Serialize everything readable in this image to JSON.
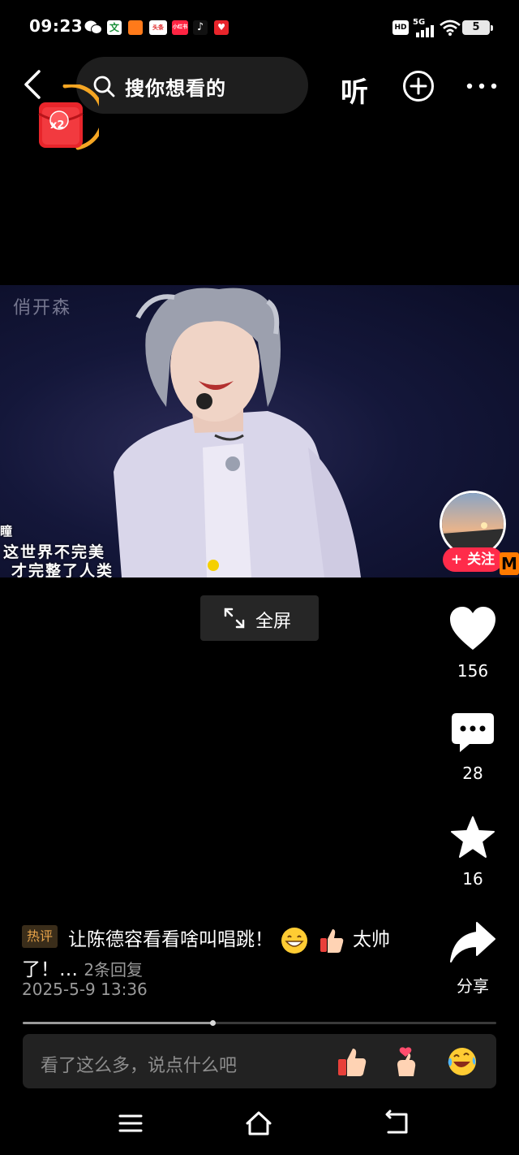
{
  "status_bar": {
    "time": "09:23",
    "notif_icons": [
      "wechat-icon",
      "wen-app-icon",
      "taobao-app-icon",
      "toutiao-app-icon",
      "xiaohongshu-app-icon",
      "douyin-app-icon",
      "red-app-icon"
    ],
    "notif_labels": [
      "",
      "文",
      "",
      "头条",
      "小红书",
      "",
      ""
    ],
    "hd_label": "HD",
    "network_label": "5G",
    "battery": "5"
  },
  "top_nav": {
    "search_placeholder": "搜你想看的",
    "listen_label": "听"
  },
  "red_packet": {
    "multiplier": "x2"
  },
  "video": {
    "watermark": "俏开森",
    "subtitle_fragment": "瞳",
    "subtitle_line1": "这世界不完美",
    "subtitle_line2": "才完整了人类",
    "brand_letter": "M"
  },
  "author": {
    "follow_label": "+ 关注"
  },
  "fullscreen": {
    "label": "全屏"
  },
  "actions": {
    "likes": "156",
    "comments": "28",
    "favorites": "16",
    "share_label": "分享"
  },
  "hot_comment": {
    "badge": "热评",
    "text_part1": "让陈德容看看啥叫唱跳！",
    "text_part2": "太帅",
    "text_line2": "了！…",
    "replies": "2条回复",
    "timestamp": "2025-5-9 13:36"
  },
  "progress": {
    "fraction": 0.4
  },
  "comment_box": {
    "placeholder": "看了这么多，说点什么吧",
    "quick_emojis": [
      "thumbs-up-icon",
      "finger-heart-icon",
      "laughing-crying-icon"
    ]
  },
  "colors": {
    "accent_red": "#ff2b4a",
    "hot_badge_text": "#e8a44a",
    "brand_orange": "#ff7a00"
  }
}
